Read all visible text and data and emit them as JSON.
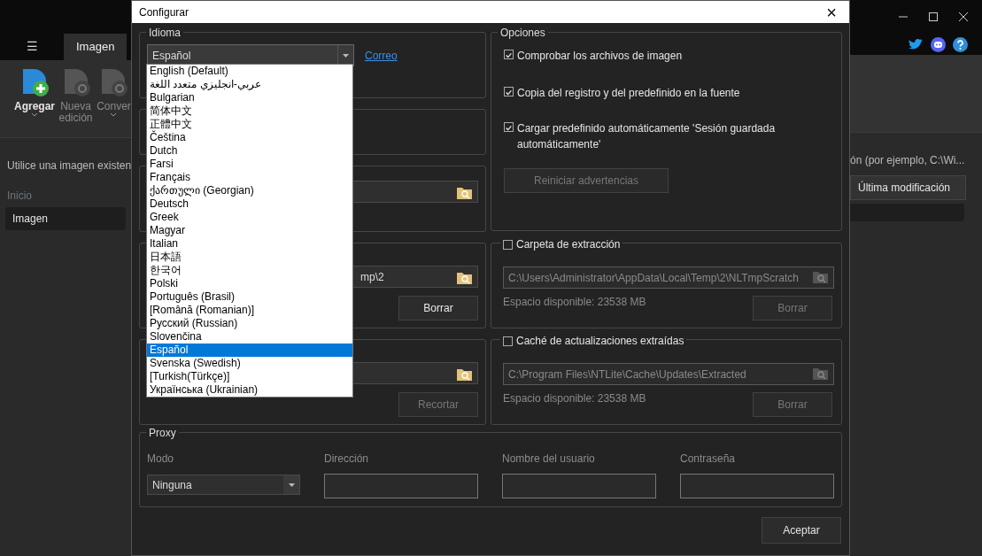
{
  "background_app": {
    "menu_button": "☰",
    "tabs": [
      {
        "label": "Imagen",
        "selected": true
      }
    ],
    "ribbon": [
      {
        "label": "Agregar",
        "disabled": false,
        "dropdown": true
      },
      {
        "label": "Nueva edición",
        "disabled": true,
        "dropdown": false
      },
      {
        "label": "Conver",
        "disabled": true,
        "dropdown": true
      }
    ],
    "hint_left": "Utilice una imagen existen",
    "hint_right": "ón (por ejemplo, C:\\Wi...",
    "sidebar_heading": "Inicio",
    "sidebar_items": [
      {
        "label": "Imagen",
        "selected": true
      }
    ],
    "column_header": "Última modificación"
  },
  "dialog": {
    "title": "Configurar",
    "close": "×",
    "language": {
      "legend": "Idioma",
      "value": "Español",
      "link": "Correo",
      "options": [
        {
          "label": "English (Default)",
          "selected": false
        },
        {
          "label": "عربي-انجليزي متعدد اللغة",
          "selected": false
        },
        {
          "label": "Bulgarian",
          "selected": false
        },
        {
          "label": "简体中文",
          "selected": false
        },
        {
          "label": "正體中文",
          "selected": false
        },
        {
          "label": "Čeština",
          "selected": false
        },
        {
          "label": "Dutch",
          "selected": false
        },
        {
          "label": "Farsi",
          "selected": false
        },
        {
          "label": "Français",
          "selected": false
        },
        {
          "label": "ქართული (Georgian)",
          "selected": false
        },
        {
          "label": "Deutsch",
          "selected": false
        },
        {
          "label": "Greek",
          "selected": false
        },
        {
          "label": "Magyar",
          "selected": false
        },
        {
          "label": "Italian",
          "selected": false
        },
        {
          "label": "日本語",
          "selected": false
        },
        {
          "label": "한국어",
          "selected": false
        },
        {
          "label": "Polski",
          "selected": false
        },
        {
          "label": "Português (Brasil)",
          "selected": false
        },
        {
          "label": "[Română (Romanian)]",
          "selected": false
        },
        {
          "label": "Русский (Russian)",
          "selected": false
        },
        {
          "label": "Slovenčina",
          "selected": false
        },
        {
          "label": "Español",
          "selected": true
        },
        {
          "label": "Svenska (Swedish)",
          "selected": false
        },
        {
          "label": "[Turkish(Türkçe)]",
          "selected": false
        },
        {
          "label": "Українська (Ukrainian)",
          "selected": false
        }
      ]
    },
    "options": {
      "legend": "Opciones",
      "checkboxes": [
        {
          "label": "Comprobar los archivos de imagen",
          "checked": true
        },
        {
          "label": "Copia del registro y del predefinido en la fuente",
          "checked": true
        },
        {
          "label": "Cargar predefinido automáticamente 'Sesión guardada automáticamente'",
          "checked": true
        }
      ],
      "reset_button": {
        "label": "Reiniciar advertencias",
        "disabled": true
      }
    },
    "left_paths": [
      {
        "kind": "folder"
      },
      {
        "kind": "folder",
        "value": "mp\\2",
        "button": {
          "label": "Borrar",
          "disabled": false
        }
      },
      {
        "kind": "folder",
        "button": {
          "label": "Recortar",
          "disabled": true
        }
      }
    ],
    "caches": [
      {
        "label": "Carpeta de extracción",
        "checked": false,
        "path": "C:\\Users\\Administrator\\AppData\\Local\\Temp\\2\\NLTmpScratch",
        "space": "Espacio disponible: 23538 MB",
        "button": {
          "label": "Borrar",
          "disabled": true
        }
      },
      {
        "label": "Caché de actualizaciones extraídas",
        "checked": false,
        "path": "C:\\Program Files\\NTLite\\Cache\\Updates\\Extracted",
        "space": "Espacio disponible: 23538 MB",
        "button": {
          "label": "Borrar",
          "disabled": true
        }
      }
    ],
    "proxy": {
      "legend": "Proxy",
      "fields": [
        {
          "kind": "select",
          "label": "Modo",
          "value": "Ninguna"
        },
        {
          "kind": "input",
          "label": "Dirección"
        },
        {
          "kind": "input",
          "label": "Nombre del usuario"
        },
        {
          "kind": "input",
          "label": "Contraseña"
        }
      ]
    },
    "ok_button": "Aceptar"
  }
}
